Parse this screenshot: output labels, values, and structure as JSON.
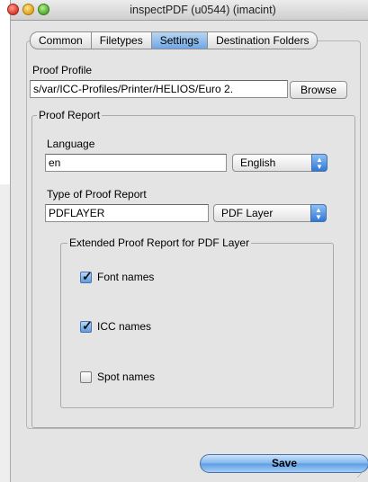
{
  "window": {
    "title": "inspectPDF (u0544) (imacint)"
  },
  "tabs": [
    {
      "label": "Common",
      "selected": false
    },
    {
      "label": "Filetypes",
      "selected": false
    },
    {
      "label": "Settings",
      "selected": true
    },
    {
      "label": "Destination Folders",
      "selected": false
    }
  ],
  "proof_profile": {
    "label": "Proof Profile",
    "value": "s/var/ICC-Profiles/Printer/HELIOS/Euro 2.",
    "browse_label": "Browse"
  },
  "proof_report": {
    "legend": "Proof Report",
    "language": {
      "label": "Language",
      "value": "en",
      "select_value": "English"
    },
    "type": {
      "label": "Type of Proof Report",
      "value": "PDFLAYER",
      "select_value": "PDF Layer"
    },
    "extended": {
      "legend": "Extended Proof Report for PDF Layer",
      "options": [
        {
          "label": "Font names",
          "checked": true
        },
        {
          "label": "ICC names",
          "checked": true
        },
        {
          "label": "Spot names",
          "checked": false
        }
      ]
    }
  },
  "footer": {
    "save_label": "Save"
  },
  "colors": {
    "accent": "#6fa6e3",
    "window_bg": "#e4e4e4"
  }
}
